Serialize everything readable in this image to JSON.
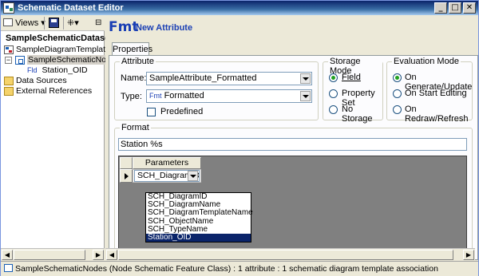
{
  "window": {
    "title": "Schematic Dataset Editor",
    "min_label": "_",
    "max_label": "□",
    "close_label": "✕"
  },
  "toolbar": {
    "views_label": "Views"
  },
  "tree": {
    "dataset": "SampleSchematicDataset",
    "template": "SampleDiagramTemplate",
    "nodes": "SampleSchematicNodes",
    "field_prefix": "Fld",
    "field": "Station_OID",
    "data_sources": "Data Sources",
    "external_refs": "External References"
  },
  "header": {
    "icon_text": "Fmt",
    "title": "New Attribute"
  },
  "tabs": {
    "properties": "Properties"
  },
  "attribute": {
    "group_label": "Attribute",
    "name_label": "Name:",
    "name_value": "SampleAttribute_Formatted",
    "type_label": "Type:",
    "type_prefix": "Fmt",
    "type_value": "Formatted",
    "predefined_label": "Predefined"
  },
  "storage": {
    "group_label": "Storage Mode",
    "field": "Field",
    "property_set": "Property Set",
    "no_storage": "No Storage"
  },
  "evaluation": {
    "group_label": "Evaluation Mode",
    "on_generate": "On Generate/Update",
    "on_start": "On Start Editing",
    "on_redraw": "On Redraw/Refresh"
  },
  "format": {
    "group_label": "Format",
    "value": "Station %s",
    "grid_header": "Parameters",
    "cell_value": "SCH_DiagramID",
    "options": [
      "SCH_DiagramID",
      "SCH_DiagramName",
      "SCH_DiagramTemplateName",
      "SCH_ObjectName",
      "SCH_TypeName",
      "Station_OID"
    ],
    "selected_option": "Station_OID"
  },
  "status": {
    "text": "SampleSchematicNodes (Node Schematic Feature Class) : 1 attribute : 1 schematic diagram template association"
  }
}
